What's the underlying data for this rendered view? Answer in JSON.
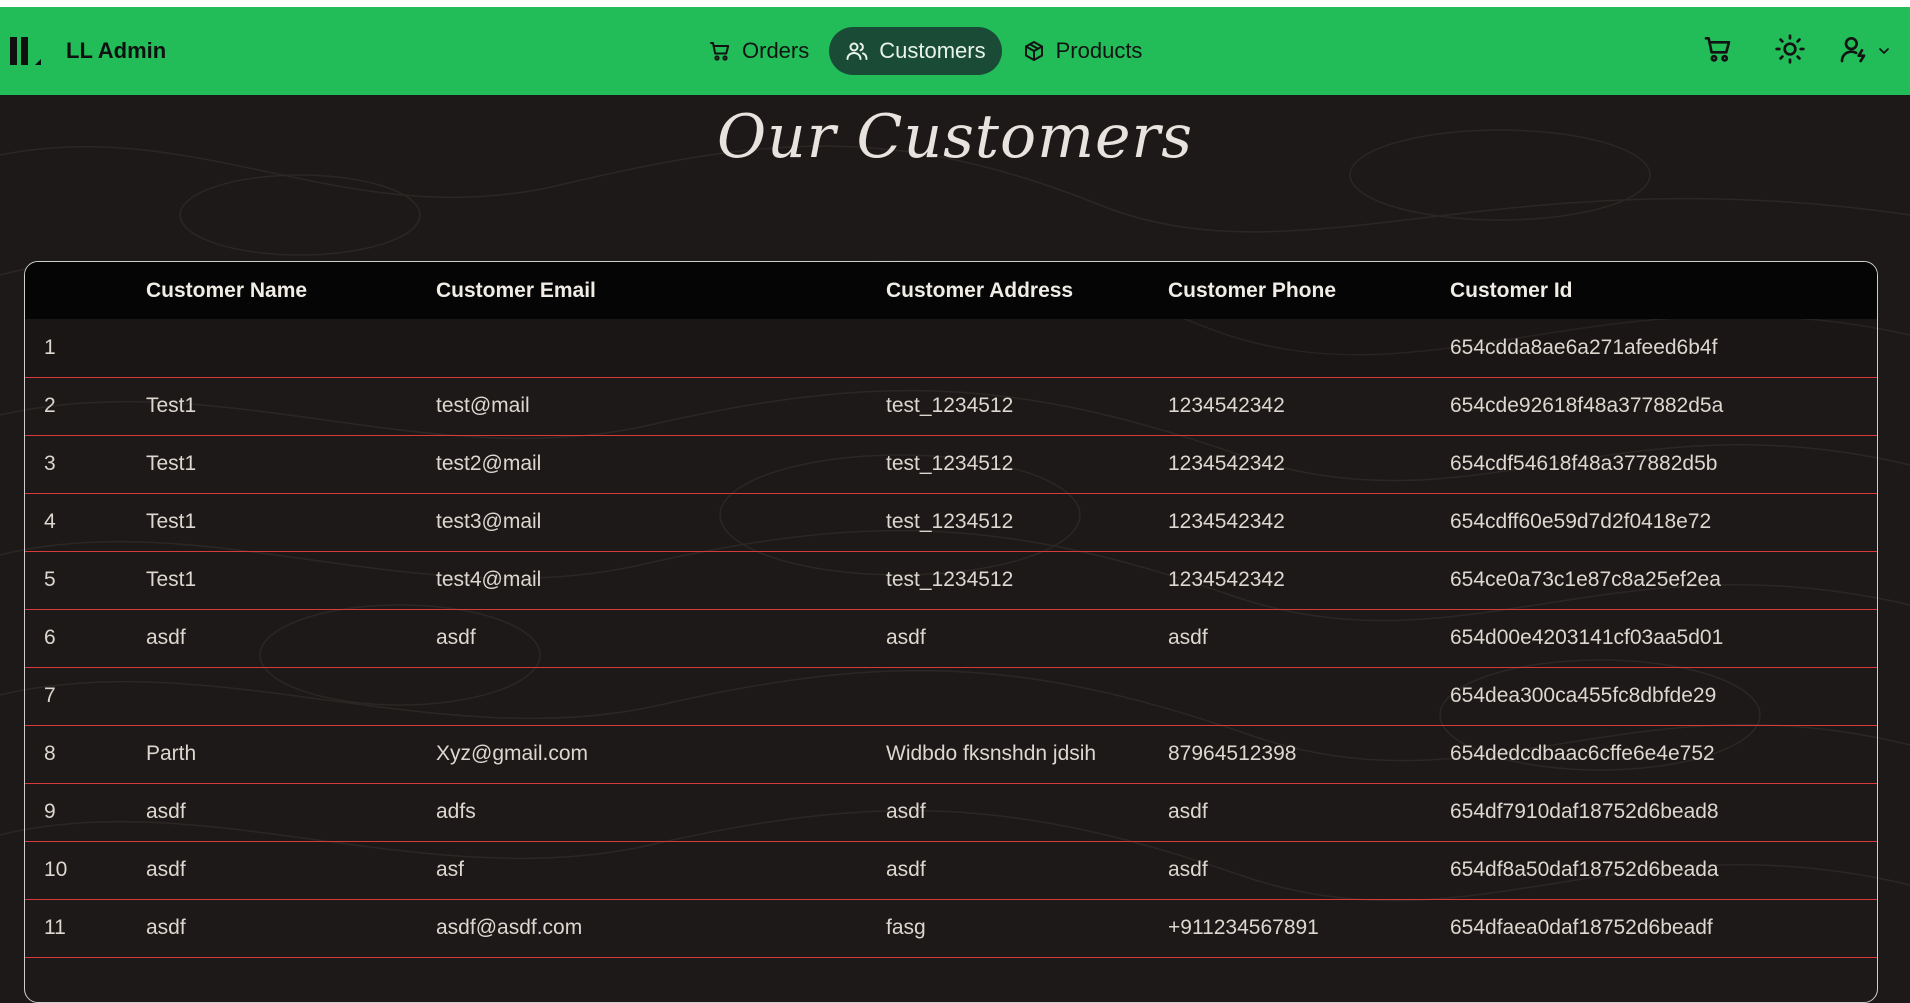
{
  "app": {
    "brand_name": "LL Admin"
  },
  "nav": {
    "items": [
      {
        "label": "Orders",
        "icon": "cart-icon",
        "active": false
      },
      {
        "label": "Customers",
        "icon": "users-icon",
        "active": true
      },
      {
        "label": "Products",
        "icon": "package-icon",
        "active": false
      }
    ],
    "right_icons": [
      "cart-icon",
      "sun-icon",
      "user-icon",
      "chevron-down-icon"
    ]
  },
  "colors": {
    "navbar": "#22bd58",
    "active_tab": "#1a4b37",
    "background": "#1c1918",
    "row_divider": "#d63a3a"
  },
  "page": {
    "title": "Our Customers"
  },
  "table": {
    "headers": [
      "",
      "Customer Name",
      "Customer Email",
      "Customer Address",
      "Customer Phone",
      "Customer Id"
    ],
    "rows": [
      [
        "1",
        "",
        "",
        "",
        "",
        "654cdda8ae6a271afeed6b4f"
      ],
      [
        "2",
        "Test1",
        "test@mail",
        "test_1234512",
        "1234542342",
        "654cde92618f48a377882d5a"
      ],
      [
        "3",
        "Test1",
        "test2@mail",
        "test_1234512",
        "1234542342",
        "654cdf54618f48a377882d5b"
      ],
      [
        "4",
        "Test1",
        "test3@mail",
        "test_1234512",
        "1234542342",
        "654cdff60e59d7d2f0418e72"
      ],
      [
        "5",
        "Test1",
        "test4@mail",
        "test_1234512",
        "1234542342",
        "654ce0a73c1e87c8a25ef2ea"
      ],
      [
        "6",
        "asdf",
        "asdf",
        "asdf",
        "asdf",
        "654d00e4203141cf03aa5d01"
      ],
      [
        "7",
        "",
        "",
        "",
        "",
        "654dea300ca455fc8dbfde29"
      ],
      [
        "8",
        "Parth",
        "Xyz@gmail.com",
        "Widbdo fksnshdn jdsih",
        "87964512398",
        "654dedcdbaac6cffe6e4e752"
      ],
      [
        "9",
        "asdf",
        "adfs",
        "asdf",
        "asdf",
        "654df7910daf18752d6bead8"
      ],
      [
        "10",
        "asdf",
        "asf",
        "asdf",
        "asdf",
        "654df8a50daf18752d6beada"
      ],
      [
        "11",
        "asdf",
        "asdf@asdf.com",
        "fasg",
        "+911234567891",
        "654dfaea0daf18752d6beadf"
      ]
    ]
  }
}
